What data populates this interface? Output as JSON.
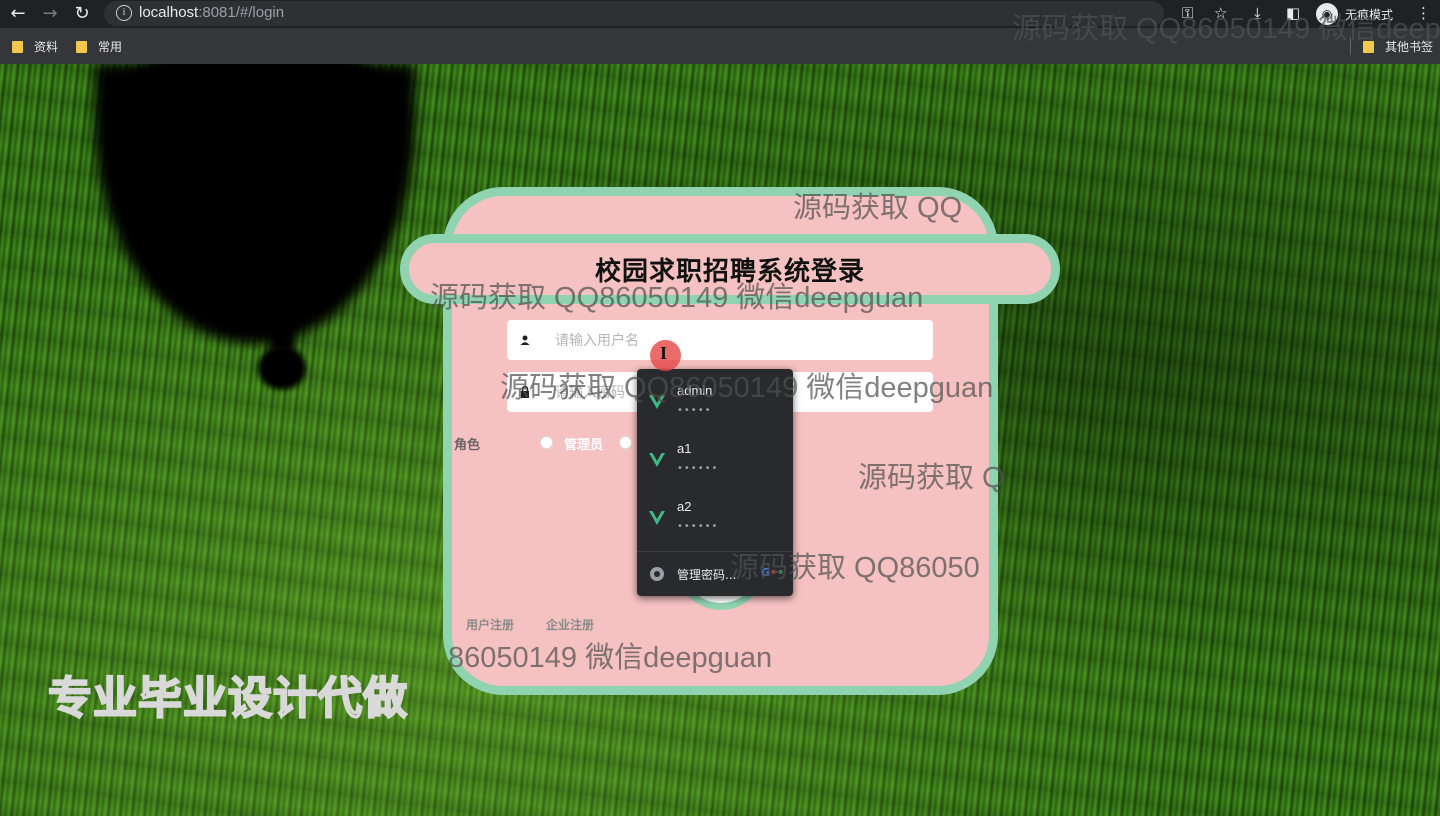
{
  "browser": {
    "url_host": "localhost",
    "url_rest": ":8081/#/login",
    "incognito_label": "无痕模式",
    "bookmarks": [
      "资料",
      "常用"
    ],
    "other_bookmarks": "其他书签"
  },
  "login": {
    "title": "校园求职招聘系统登录",
    "username_placeholder": "请输入用户名",
    "password_placeholder": "请输入密码",
    "role_label": "角色",
    "role_options": [
      "管理员"
    ],
    "register_links": [
      "用户注册",
      "企业注册"
    ]
  },
  "autocomplete": {
    "accounts": [
      {
        "username": "admin",
        "password_mask": "•••••"
      },
      {
        "username": "a1",
        "password_mask": "••••••"
      },
      {
        "username": "a2",
        "password_mask": "••••••"
      }
    ],
    "manage_label": "管理密码..."
  },
  "watermarks": {
    "repeated": "源码获取 QQ86050149 微信deepguan",
    "short": "源码获取 QQ",
    "short2": "源码获取 Q",
    "mid": "源码获取 QQ86050",
    "tail": "86050149 微信deepguan",
    "big": "专业毕业设计代做"
  },
  "colors": {
    "card_bg": "#f6c1c1",
    "card_border": "#8fd3b1",
    "dropdown_bg": "#292a2d",
    "vue_green": "#41b883"
  }
}
